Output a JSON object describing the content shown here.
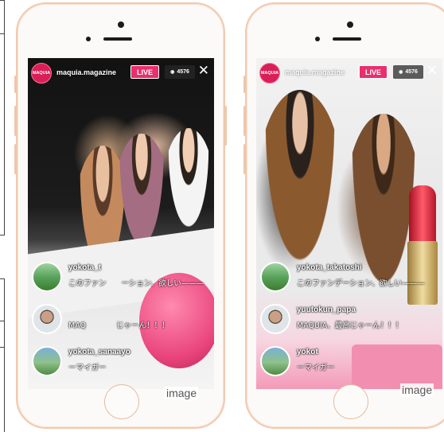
{
  "phones": [
    {
      "account": "maquia.magazine",
      "logo_text": "MAQUIA",
      "live_label": "LIVE",
      "viewer_count": "4576",
      "close_glyph": "✕",
      "comments": [
        {
          "username": "yokota_t",
          "text": "このファン　　ーション、欲しい———"
        },
        {
          "username": "",
          "text": "MAQ　　　　じゃーん！！！"
        },
        {
          "username": "yokota_sanaayo",
          "text": "ーマイガー"
        }
      ],
      "caption": "image"
    },
    {
      "account": "maquia.magazine",
      "logo_text": "MAQUIA",
      "live_label": "LIVE",
      "viewer_count": "4576",
      "close_glyph": "✕",
      "comments": [
        {
          "username": "yokota_takatoshi",
          "text": "このファンデーション、欲しい———"
        },
        {
          "username": "yuutokun_papa",
          "text": "MAQUIA、最高じゃーん！！！"
        },
        {
          "username": "yokot",
          "text": "ーマイガー"
        }
      ],
      "caption": "image"
    }
  ],
  "colors": {
    "live_pink": "#e92f6e",
    "phone_frame": "#f2c9ae",
    "logo_red": "#d81f57"
  },
  "icons": [
    "eye-icon",
    "close-icon",
    "home-button",
    "front-camera",
    "speaker"
  ]
}
